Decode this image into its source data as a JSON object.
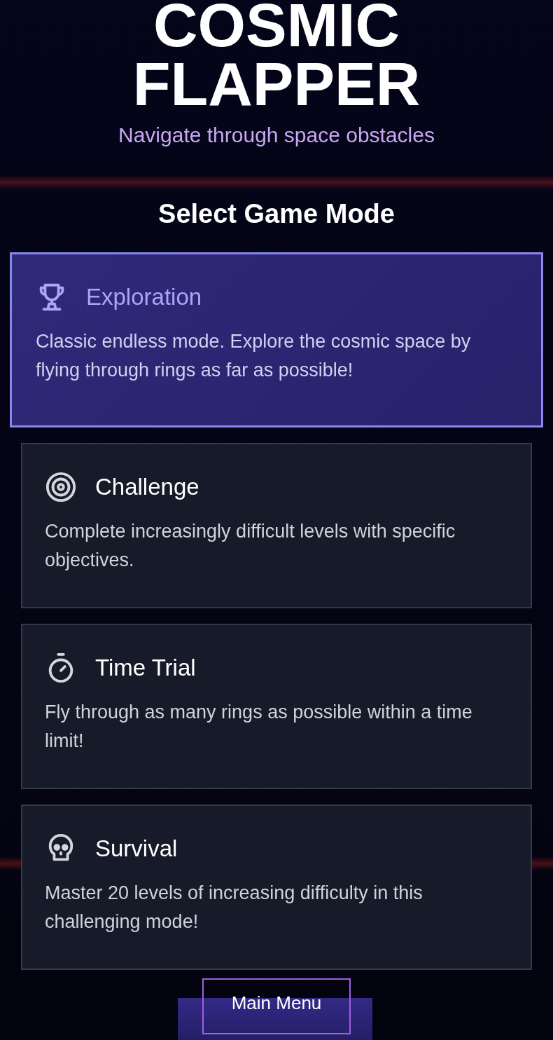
{
  "title": [
    "COSMIC",
    "FLAPPER"
  ],
  "subtitle": "Navigate through space obstacles",
  "heading": "Select Game Mode",
  "modes": [
    {
      "kind": "trophy",
      "name": "Exploration",
      "description": "Classic endless mode. Explore the cosmic space by flying through rings as far as possible!",
      "selected": true
    },
    {
      "kind": "target",
      "name": "Challenge",
      "description": "Complete increasingly difficult levels with specific objectives.",
      "selected": false
    },
    {
      "kind": "timer",
      "name": "Time Trial",
      "description": "Fly through as many rings as possible within a time limit!",
      "selected": false
    },
    {
      "kind": "skull",
      "name": "Survival",
      "description": "Master 20 levels of increasing difficulty in this challenging mode!",
      "selected": false
    }
  ],
  "main_menu_button": "Main Menu"
}
